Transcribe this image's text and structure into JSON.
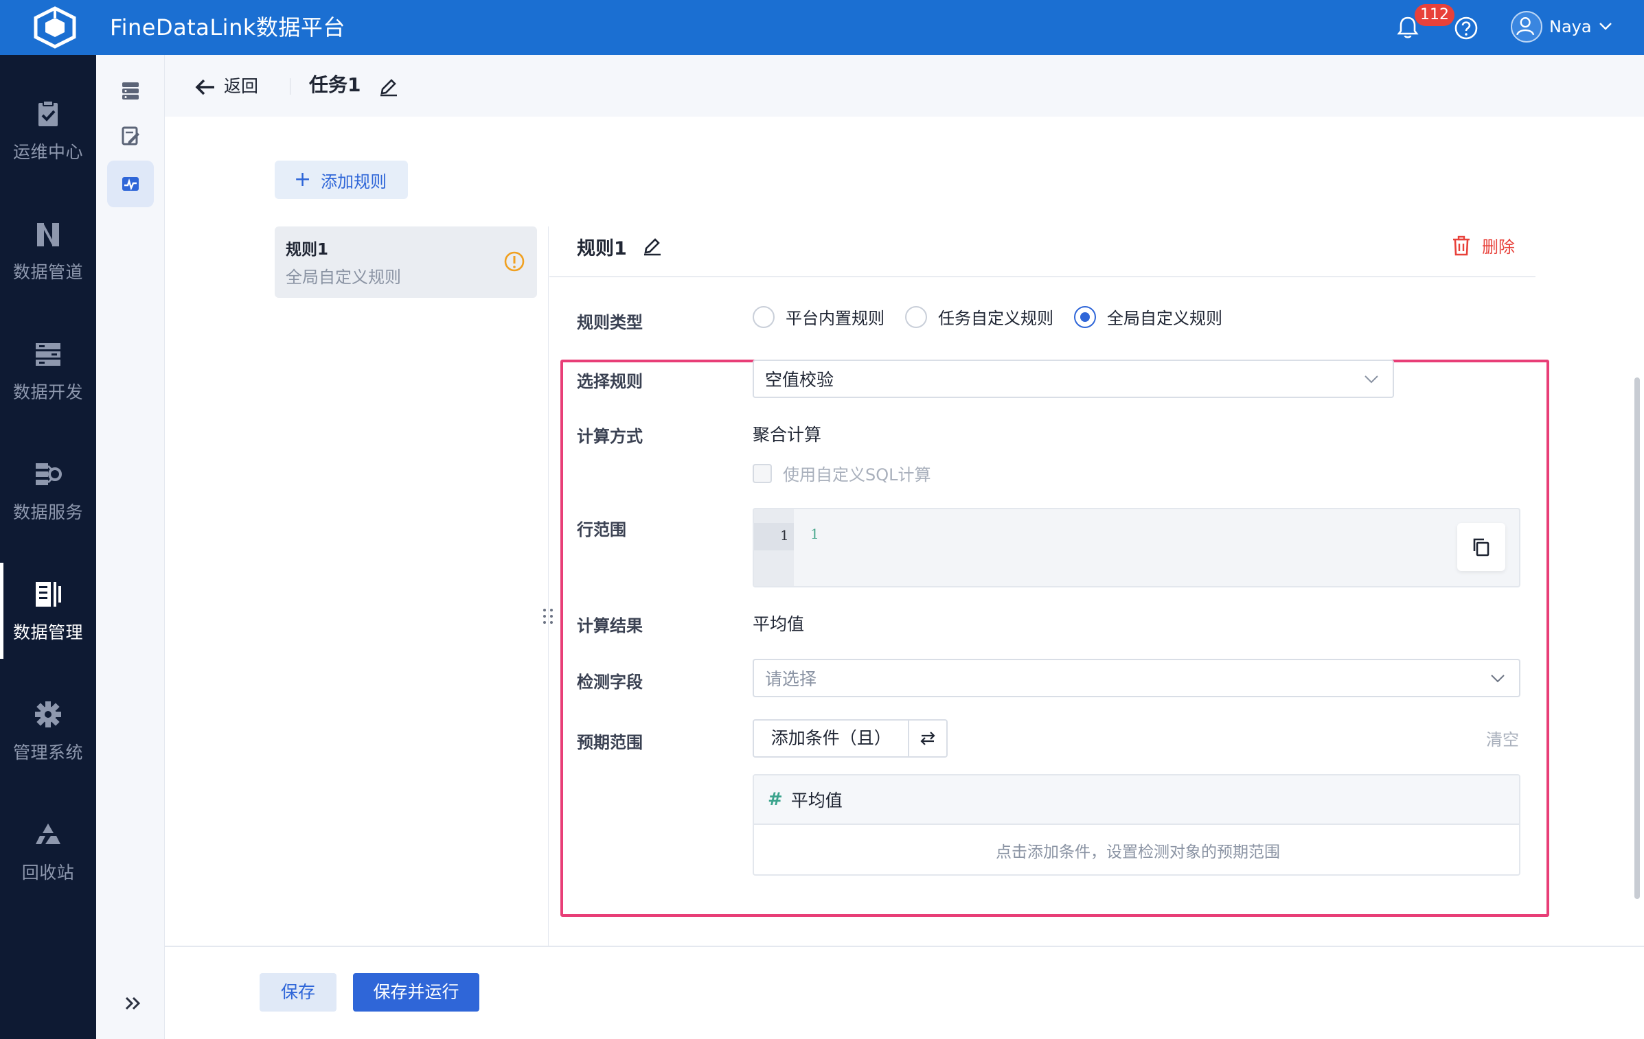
{
  "app": {
    "title": "FineDataLink数据平台"
  },
  "topbar": {
    "notification_count": "112",
    "user_name": "Naya"
  },
  "leftnav": {
    "items": [
      {
        "label": "运维中心",
        "icon": "clipboard-check-icon",
        "active": false
      },
      {
        "label": "数据管道",
        "icon": "pipeline-icon",
        "active": false
      },
      {
        "label": "数据开发",
        "icon": "dev-stack-icon",
        "active": false
      },
      {
        "label": "数据服务",
        "icon": "service-icon",
        "active": false
      },
      {
        "label": "数据管理",
        "icon": "data-manage-icon",
        "active": true
      },
      {
        "label": "管理系统",
        "icon": "gear-icon",
        "active": false
      },
      {
        "label": "回收站",
        "icon": "recycle-icon",
        "active": false
      }
    ]
  },
  "header": {
    "back_label": "返回",
    "task_title": "任务1"
  },
  "content": {
    "add_rule_label": "添加规则",
    "rule_list": [
      {
        "title": "规则1",
        "subtitle": "全局自定义规则",
        "status": "warning"
      }
    ],
    "panel": {
      "title": "规则1",
      "delete_label": "删除",
      "rule_type": {
        "label": "规则类型",
        "options": [
          "平台内置规则",
          "任务自定义规则",
          "全局自定义规则"
        ],
        "selected": "全局自定义规则"
      },
      "select_rule": {
        "label": "选择规则",
        "value": "空值校验"
      },
      "calc_method": {
        "label": "计算方式",
        "value": "聚合计算",
        "checkbox_label": "使用自定义SQL计算"
      },
      "row_range": {
        "label": "行范围",
        "line_number": "1",
        "code": "1"
      },
      "calc_result": {
        "label": "计算结果",
        "value": "平均值"
      },
      "detect_field": {
        "label": "检测字段",
        "placeholder": "请选择"
      },
      "expected_range": {
        "label": "预期范围",
        "add_condition_label": "添加条件（且）",
        "clear_label": "清空",
        "metric_name": "平均值",
        "hint": "点击添加条件，设置检测对象的预期范围"
      }
    }
  },
  "footer": {
    "save_label": "保存",
    "save_run_label": "保存并运行"
  },
  "colors": {
    "primary": "#2f66d8",
    "topbar": "#1b6fd2",
    "nav_bg": "#0e1a33",
    "danger": "#e8413a",
    "highlight": "#e83e77"
  }
}
